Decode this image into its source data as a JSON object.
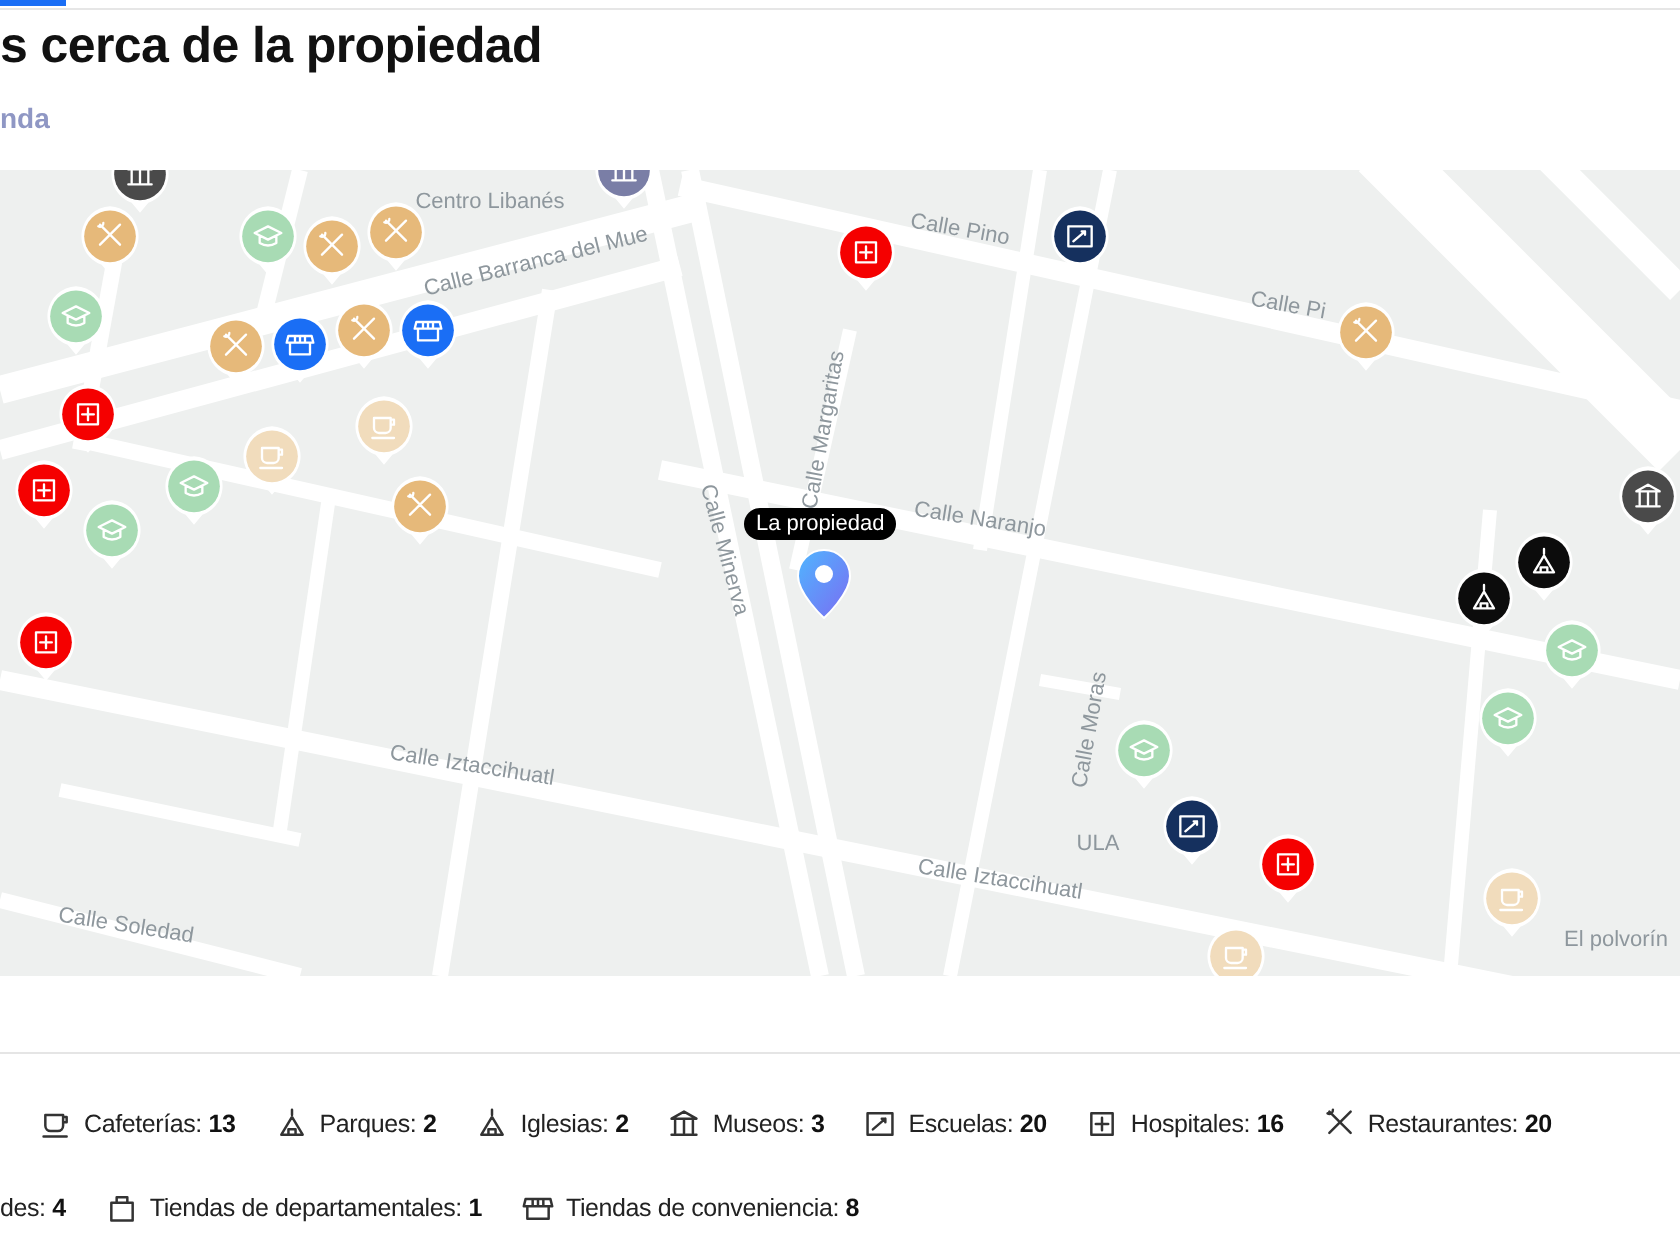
{
  "title": "s cerca de la propiedad",
  "subtitle": "nda",
  "map": {
    "property_label": "La propiedad",
    "labels": [
      {
        "text": "Centro Libanés"
      },
      {
        "text": "Calle Barranca del Mue"
      },
      {
        "text": "Calle Pino"
      },
      {
        "text": "Calle Pi"
      },
      {
        "text": "Calle Margaritas"
      },
      {
        "text": "Calle Naranjo"
      },
      {
        "text": "Calle Minerva"
      },
      {
        "text": "Calle Iztaccihuatl"
      },
      {
        "text": "Calle Iztaccihuatl"
      },
      {
        "text": "Calle Soledad"
      },
      {
        "text": "Calle Moras"
      },
      {
        "text": "ULA"
      },
      {
        "text": "El polvorín"
      }
    ],
    "pins": [
      {
        "kind": "museum"
      },
      {
        "kind": "restaurant"
      },
      {
        "kind": "school"
      },
      {
        "kind": "restaurant"
      },
      {
        "kind": "restaurant"
      },
      {
        "kind": "school"
      },
      {
        "kind": "restaurant"
      },
      {
        "kind": "store"
      },
      {
        "kind": "restaurant"
      },
      {
        "kind": "store"
      },
      {
        "kind": "hospital"
      },
      {
        "kind": "hospital"
      },
      {
        "kind": "school"
      },
      {
        "kind": "school"
      },
      {
        "kind": "cafe"
      },
      {
        "kind": "cafe"
      },
      {
        "kind": "restaurant"
      },
      {
        "kind": "landmark"
      },
      {
        "kind": "hospital"
      },
      {
        "kind": "academy"
      },
      {
        "kind": "restaurant"
      },
      {
        "kind": "museum"
      },
      {
        "kind": "church"
      },
      {
        "kind": "church"
      },
      {
        "kind": "school"
      },
      {
        "kind": "school"
      },
      {
        "kind": "hospital"
      },
      {
        "kind": "school"
      },
      {
        "kind": "academy"
      },
      {
        "kind": "hospital"
      },
      {
        "kind": "cafe"
      },
      {
        "kind": "cafe"
      }
    ]
  },
  "legend": [
    [
      {
        "kind": "cafe",
        "text": "Cafeterías: **13**"
      },
      {
        "kind": "park",
        "text": "Parques: **2**"
      },
      {
        "kind": "church",
        "text": "Iglesias: **2**"
      },
      {
        "kind": "museum",
        "text": "Museos: **3**"
      },
      {
        "kind": "academy",
        "text": "Escuelas: **20**"
      },
      {
        "kind": "hospital",
        "text": "Hospitales: **16**"
      },
      {
        "kind": "restaurant",
        "text": "Restaurantes: **20**"
      }
    ],
    [
      {
        "kind": "cut",
        "text": "des: **4**"
      },
      {
        "kind": "bag",
        "text": "Tiendas de departamentales: **1**"
      },
      {
        "kind": "store",
        "text": "Tiendas de conveniencia: **8**"
      }
    ]
  ]
}
